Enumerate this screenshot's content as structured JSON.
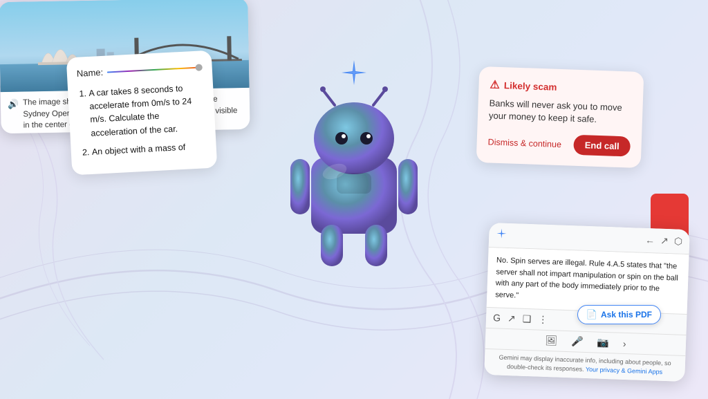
{
  "background": {
    "gradient_start": "#e8e0f0",
    "gradient_end": "#ede8f8"
  },
  "homework_card": {
    "name_label": "Name:",
    "items": [
      "A car takes 8 seconds to accelerate from 0m/s to 24 m/s. Calculate the acceleration of the car.",
      "An object with a mass of"
    ]
  },
  "scam_card": {
    "header": "Likely scam",
    "body": "Banks will never ask you to move your money to keep it safe.",
    "dismiss_label": "Dismiss & continue",
    "end_call_label": "End call"
  },
  "sydney_card": {
    "caption": "The image shows a wide shot of Sydney, Australia. The Sydney Opera House and Sydney Harbour Bridge are visible in the center of the image. The sky is clear and blue."
  },
  "pdf_panel": {
    "content": "No. Spin serves are illegal. Rule 4.A.5 states that \"the server shall not impart manipulation or spin on the ball with any part of the body immediately prior to the serve.\"",
    "ask_button_label": "Ask this PDF",
    "disclaimer": "Gemini may display inaccurate info, including about people, so double-check its responses.",
    "privacy_link": "Your privacy & Gemini Apps"
  },
  "icons": {
    "sparkle": "✦",
    "speaker": "🔊",
    "warning": "⚠",
    "pdf": "📄",
    "gem": "◆",
    "back": "←",
    "share": "↗",
    "more": "⋮",
    "image": "🖼",
    "mic": "🎤",
    "photo": "📷",
    "forward": "›"
  }
}
